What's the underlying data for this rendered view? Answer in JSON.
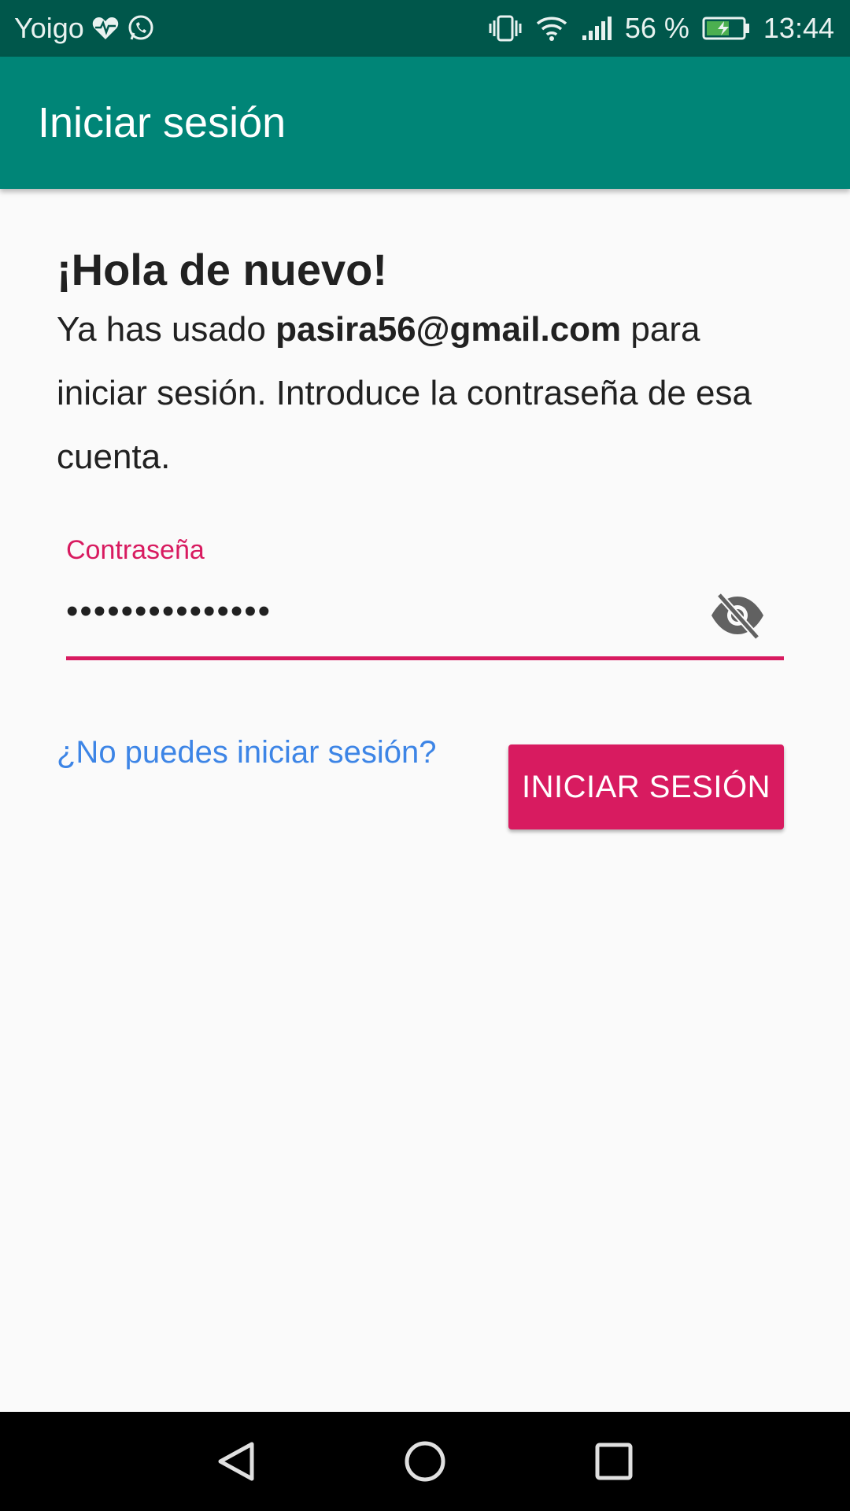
{
  "status_bar": {
    "carrier": "Yoigo",
    "battery_percent": "56 %",
    "time": "13:44",
    "icons": [
      "heart-pulse-icon",
      "whatsapp-icon",
      "vibrate-icon",
      "wifi-icon",
      "signal-icon",
      "battery-charging-icon"
    ]
  },
  "app_bar": {
    "title": "Iniciar sesión"
  },
  "content": {
    "heading": "¡Hola de nuevo!",
    "message_prefix": "Ya has usado ",
    "email": "pasira56@gmail.com",
    "message_suffix": " para iniciar sesión. Introduce la contraseña de esa cuenta.",
    "password_label": "Contraseña",
    "password_value": "•••••••••••••••",
    "visibility_icon": "visibility-off-icon",
    "forgot_link": "¿No puedes iniciar sesión?",
    "login_button": "INICIAR SESIÓN"
  },
  "nav_bar": {
    "icons": [
      "back-icon",
      "home-icon",
      "recents-icon"
    ]
  },
  "colors": {
    "status_bar": "#00574b",
    "app_bar": "#008577",
    "accent": "#d81b60",
    "link": "#3d85e6"
  }
}
